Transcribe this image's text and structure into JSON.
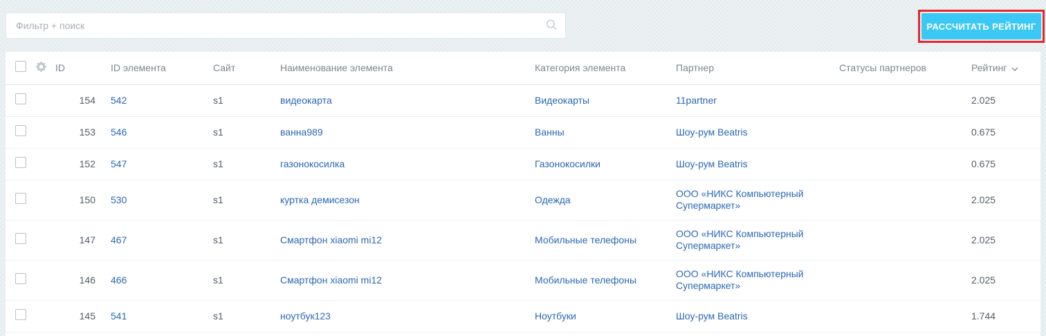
{
  "filter": {
    "placeholder": "Фильтр + поиск"
  },
  "actions": {
    "calculate_rating": "РАССЧИТАТЬ РЕЙТИНГ"
  },
  "colors": {
    "button-bg": "#3bc8f5",
    "annotation-red": "#e8252b",
    "link-blue": "#2a67b5"
  },
  "table": {
    "columns": {
      "id": "ID",
      "element_id": "ID элемента",
      "site": "Сайт",
      "name": "Наименование элемента",
      "category": "Категория элемента",
      "partner": "Партнер",
      "partner_statuses": "Статусы партнеров",
      "rating": "Рейтинг"
    },
    "sorted_by": "Рейтинг",
    "sort_direction": "desc",
    "rows": [
      {
        "id": "154",
        "element_id": "542",
        "site": "s1",
        "name": "видеокарта",
        "category": "Видеокарты",
        "partner": "11partner",
        "partner_statuses": "",
        "rating": "2.025"
      },
      {
        "id": "153",
        "element_id": "546",
        "site": "s1",
        "name": "ванна989",
        "category": "Ванны",
        "partner": "Шоу-рум Beatris",
        "partner_statuses": "",
        "rating": "0.675"
      },
      {
        "id": "152",
        "element_id": "547",
        "site": "s1",
        "name": "газонокосилка",
        "category": "Газонокосилки",
        "partner": "Шоу-рум Beatris",
        "partner_statuses": "",
        "rating": "0.675"
      },
      {
        "id": "150",
        "element_id": "530",
        "site": "s1",
        "name": "куртка демисезон",
        "category": "Одежда",
        "partner": "ООО «НИКС Компьютерный Супермаркет»",
        "partner_statuses": "",
        "rating": "2.025"
      },
      {
        "id": "147",
        "element_id": "467",
        "site": "s1",
        "name": "Смартфон xiaomi mi12",
        "category": "Мобильные телефоны",
        "partner": "ООО «НИКС Компьютерный Супермаркет»",
        "partner_statuses": "",
        "rating": "2.025"
      },
      {
        "id": "146",
        "element_id": "466",
        "site": "s1",
        "name": "Смартфон xiaomi mi12",
        "category": "Мобильные телефоны",
        "partner": "ООО «НИКС Компьютерный Супермаркет»",
        "partner_statuses": "",
        "rating": "2.025"
      },
      {
        "id": "145",
        "element_id": "541",
        "site": "s1",
        "name": "ноутбук123",
        "category": "Ноутбуки",
        "partner": "Шоу-рум Beatris",
        "partner_statuses": "",
        "rating": "1.744"
      }
    ]
  }
}
